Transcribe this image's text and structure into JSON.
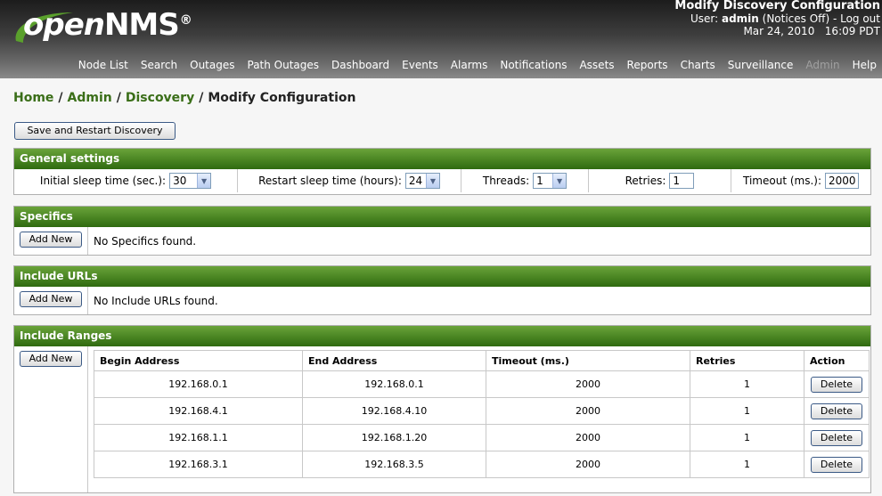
{
  "header": {
    "logo_main": "open",
    "logo_brand": "NMS",
    "logo_reg": "®",
    "page_title": "Modify Discovery Configuration",
    "user_prefix": "User: ",
    "user_name": "admin",
    "notices": " (Notices Off) - ",
    "logout": "Log out",
    "date": "Mar 24, 2010",
    "time": "16:09 PDT"
  },
  "nav": [
    {
      "label": "Node List"
    },
    {
      "label": "Search"
    },
    {
      "label": "Outages"
    },
    {
      "label": "Path Outages"
    },
    {
      "label": "Dashboard"
    },
    {
      "label": "Events"
    },
    {
      "label": "Alarms"
    },
    {
      "label": "Notifications"
    },
    {
      "label": "Assets"
    },
    {
      "label": "Reports"
    },
    {
      "label": "Charts"
    },
    {
      "label": "Surveillance"
    },
    {
      "label": "Admin"
    },
    {
      "label": "Help"
    }
  ],
  "breadcrumb": {
    "home": "Home",
    "admin": "Admin",
    "discovery": "Discovery",
    "current": "Modify Configuration",
    "sep": "/"
  },
  "save_button": "Save and Restart Discovery",
  "general": {
    "title": "General settings",
    "initial_sleep_label": "Initial sleep time (sec.):",
    "initial_sleep_value": "30",
    "restart_sleep_label": "Restart sleep time (hours):",
    "restart_sleep_value": "24",
    "threads_label": "Threads:",
    "threads_value": "1",
    "retries_label": "Retries:",
    "retries_value": "1",
    "timeout_label": "Timeout (ms.):",
    "timeout_value": "2000"
  },
  "specifics": {
    "title": "Specifics",
    "add_label": "Add New",
    "empty": "No Specifics found."
  },
  "urls": {
    "title": "Include URLs",
    "add_label": "Add New",
    "empty": "No Include URLs found."
  },
  "ranges": {
    "title": "Include Ranges",
    "add_label": "Add New",
    "headers": {
      "begin": "Begin Address",
      "end": "End Address",
      "timeout": "Timeout (ms.)",
      "retries": "Retries",
      "action": "Action"
    },
    "delete_label": "Delete",
    "rows": [
      {
        "begin": "192.168.0.1",
        "end": "192.168.0.1",
        "timeout": "2000",
        "retries": "1"
      },
      {
        "begin": "192.168.4.1",
        "end": "192.168.4.10",
        "timeout": "2000",
        "retries": "1"
      },
      {
        "begin": "192.168.1.1",
        "end": "192.168.1.20",
        "timeout": "2000",
        "retries": "1"
      },
      {
        "begin": "192.168.3.1",
        "end": "192.168.3.5",
        "timeout": "2000",
        "retries": "1"
      }
    ]
  }
}
